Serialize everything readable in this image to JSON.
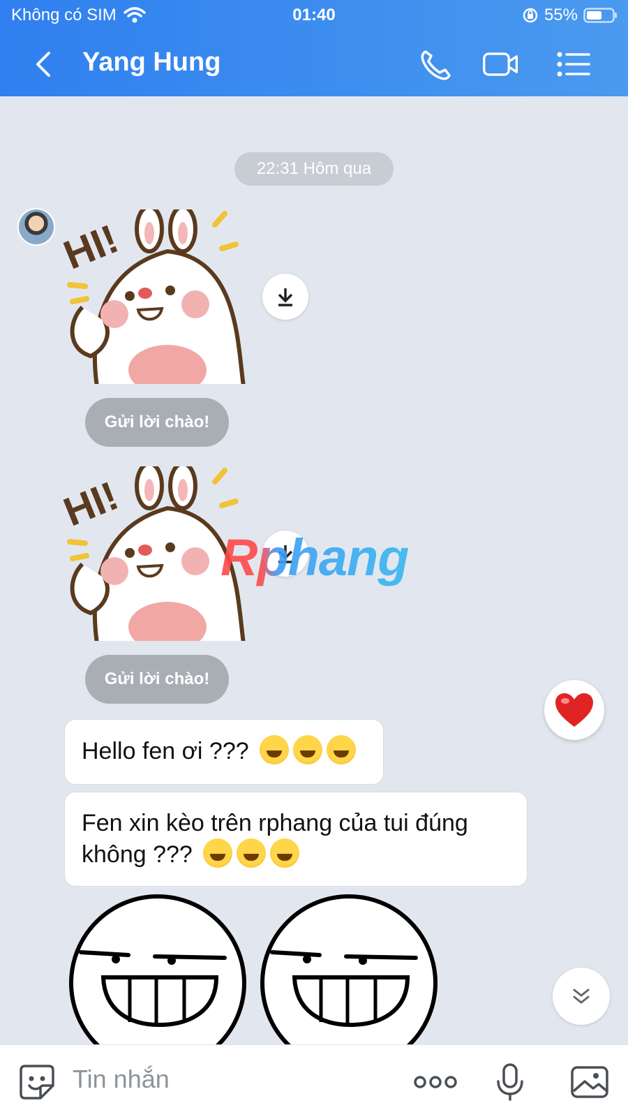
{
  "status": {
    "carrier": "Không có SIM",
    "time": "01:40",
    "battery": "55%"
  },
  "header": {
    "title": "Yang Hung",
    "icons": [
      "back-chevron-icon",
      "phone-icon",
      "video-call-icon",
      "menu-list-icon"
    ]
  },
  "chat": {
    "timestamp": "22:31 Hôm qua",
    "greet_label": "Gửi lời chào!",
    "sticker_text": "HI!",
    "watermark": "Rphang",
    "messages": [
      {
        "text": "Hello fen ơi ???",
        "emoji": "🤣🤣🤣"
      },
      {
        "text": "Fen xin kèo trên rphang của tui đúng không ???",
        "emoji": "😀😀😀"
      }
    ]
  },
  "composer": {
    "placeholder": "Tin nhắn"
  },
  "colors": {
    "header_start": "#2f7ff0",
    "header_end": "#4a9aef",
    "chat_bg": "#e2e7ef",
    "greet_pill": "#a9adb4",
    "heart": "#e02424"
  }
}
